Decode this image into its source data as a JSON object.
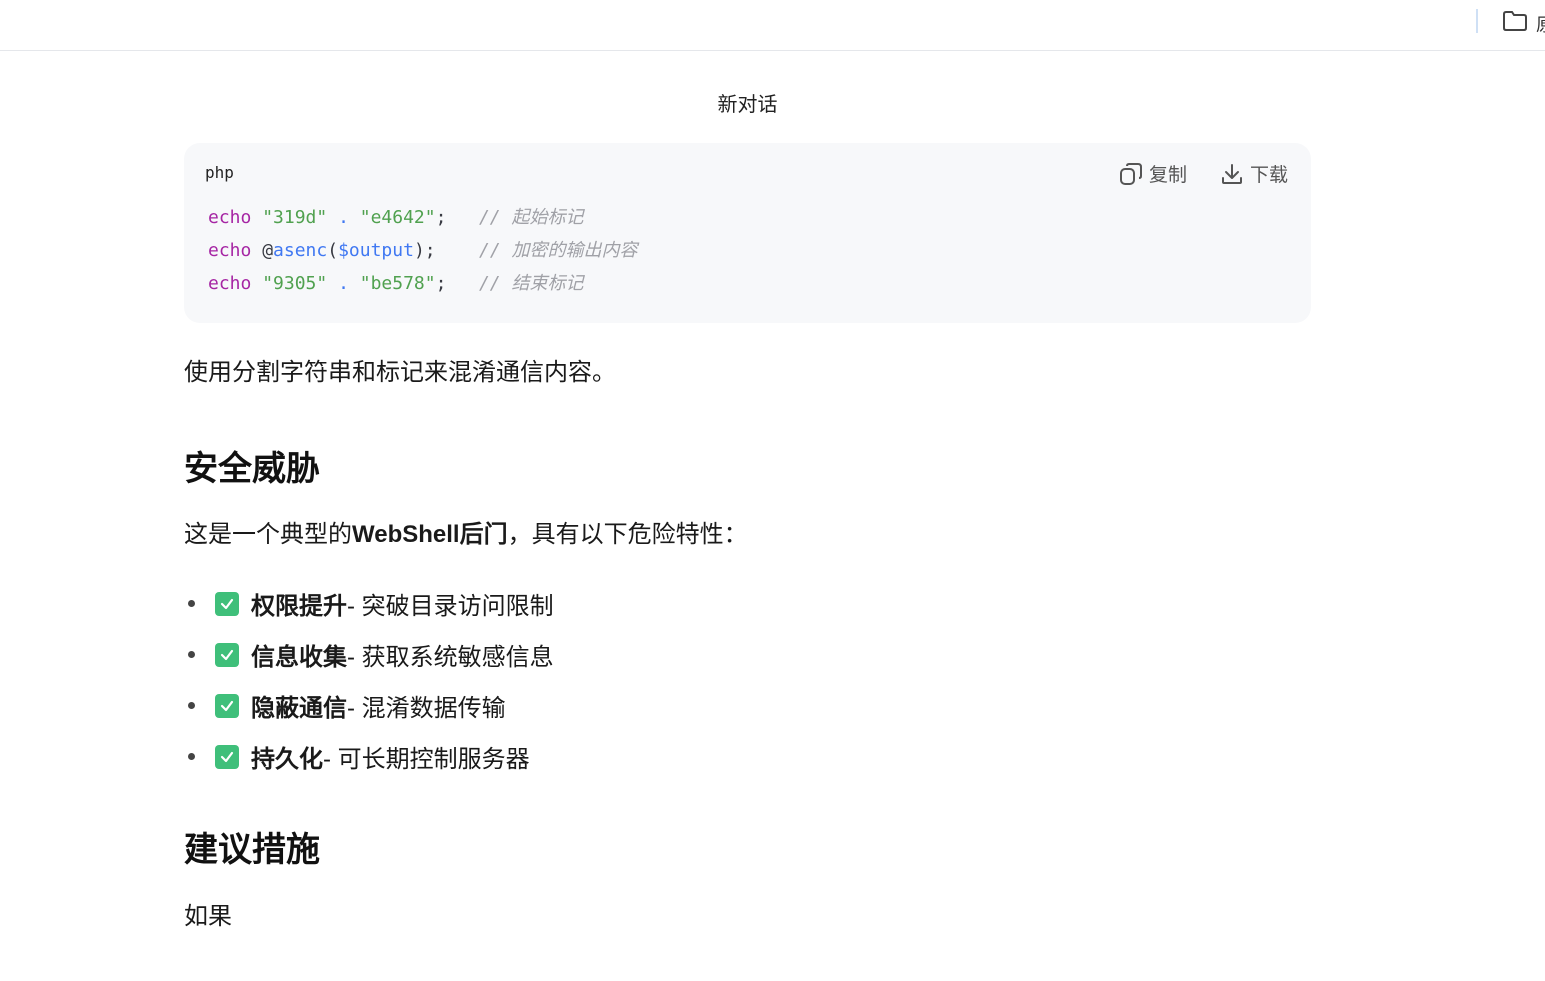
{
  "topbar": {
    "folder_icon": "folder-icon",
    "folder_label": "原"
  },
  "conversation_title": "新对话",
  "code_block": {
    "language": "php",
    "copy_label": "复制",
    "download_label": "下载",
    "copy_icon": "copy-icon",
    "download_icon": "download-icon",
    "lines": [
      {
        "kw": "echo",
        "s1": "\"319d\"",
        "op": " . ",
        "s2": "\"e4642\"",
        "end": ";",
        "comment": "// 起始标记"
      },
      {
        "kw": "echo",
        "at": "@",
        "fn": "asenc",
        "var": "$output",
        "end": ");",
        "comment": "// 加密的输出内容"
      },
      {
        "kw": "echo",
        "s1": "\"9305\"",
        "op": " . ",
        "s2": "\"be578\"",
        "end": ";",
        "comment": "// 结束标记"
      }
    ]
  },
  "paragraph1": "使用分割字符串和标记来混淆通信内容。",
  "section1_heading": "安全威胁",
  "section1_intro": {
    "prefix": "这是一个典型的",
    "bold": "WebShell后门",
    "suffix": "，具有以下危险特性："
  },
  "features": [
    {
      "title": "权限提升",
      "desc": " - 突破目录访问限制"
    },
    {
      "title": "信息收集",
      "desc": " - 获取系统敏感信息"
    },
    {
      "title": "隐蔽通信",
      "desc": " - 混淆数据传输"
    },
    {
      "title": "持久化",
      "desc": " - 可长期控制服务器"
    }
  ],
  "section2_heading": "建议措施",
  "section2_text": "如果",
  "colors": {
    "keyword": "#a626a4",
    "string": "#50a14f",
    "function": "#4078f2",
    "comment": "#a0a1a7",
    "check": "#3fbf7a"
  }
}
